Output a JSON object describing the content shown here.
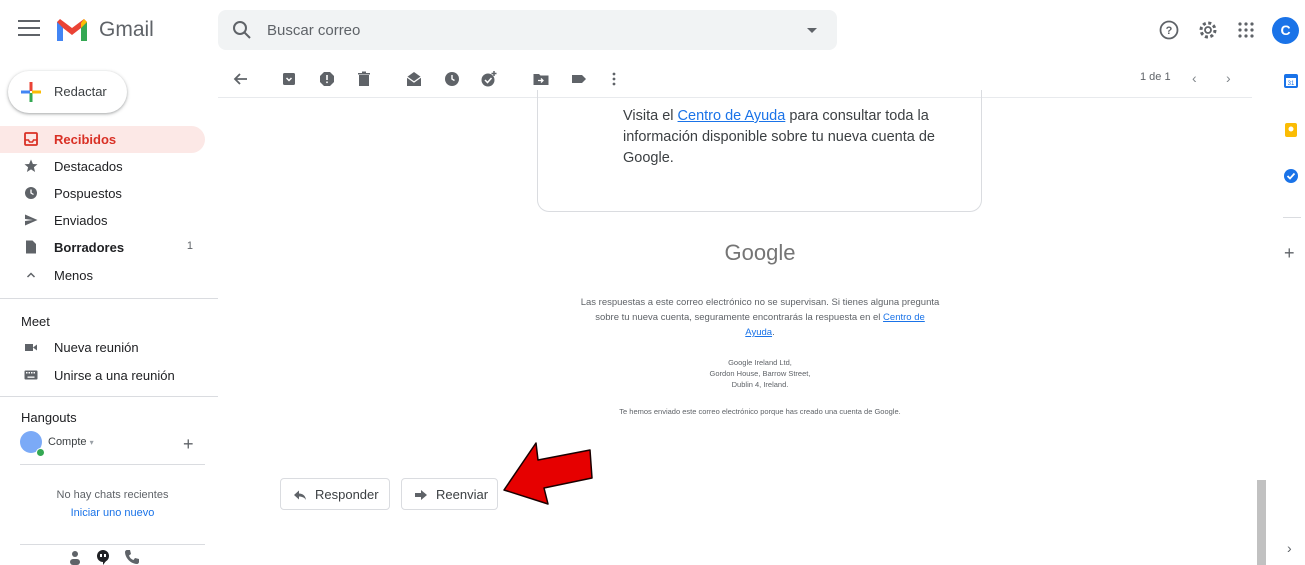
{
  "app": {
    "name": "Gmail"
  },
  "search": {
    "placeholder": "Buscar correo"
  },
  "account": {
    "initial": "C"
  },
  "compose": {
    "label": "Redactar"
  },
  "sidebar": {
    "items": [
      {
        "label": "Recibidos",
        "count": ""
      },
      {
        "label": "Destacados",
        "count": ""
      },
      {
        "label": "Pospuestos",
        "count": ""
      },
      {
        "label": "Enviados",
        "count": ""
      },
      {
        "label": "Borradores",
        "count": "1"
      },
      {
        "label": "Menos",
        "count": ""
      }
    ]
  },
  "meet": {
    "title": "Meet",
    "new_meeting": "Nueva reunión",
    "join_meeting": "Unirse a una reunión"
  },
  "hangouts": {
    "title": "Hangouts",
    "user": "Compte",
    "no_chats": "No hay chats recientes",
    "start_new": "Iniciar uno nuevo"
  },
  "pager": {
    "text": "1 de 1"
  },
  "email": {
    "card_text_before": "Visita el ",
    "card_link": "Centro de Ayuda",
    "card_text_after": " para consultar toda la información disponible sobre tu nueva cuenta de Google.",
    "brand": "Google",
    "footer_p1_before": "Las respuestas a este correo electrónico no se supervisan. Si tienes alguna pregunta sobre tu nueva cuenta, seguramente encontrarás la respuesta en el ",
    "footer_p1_link": "Centro de Ayuda",
    "footer_p1_after": ".",
    "address_line1": "Google Ireland Ltd,",
    "address_line2": "Gordon House, Barrow Street,",
    "address_line3": "Dublin 4, Ireland.",
    "footer_p3": "Te hemos enviado este correo electrónico porque has creado una cuenta de Google."
  },
  "actions": {
    "reply": "Responder",
    "forward": "Reenviar"
  },
  "colors": {
    "accent_red": "#d93025",
    "active_bg": "#fce8e6",
    "link_blue": "#1a73e8",
    "arrow_red": "#e60000"
  }
}
